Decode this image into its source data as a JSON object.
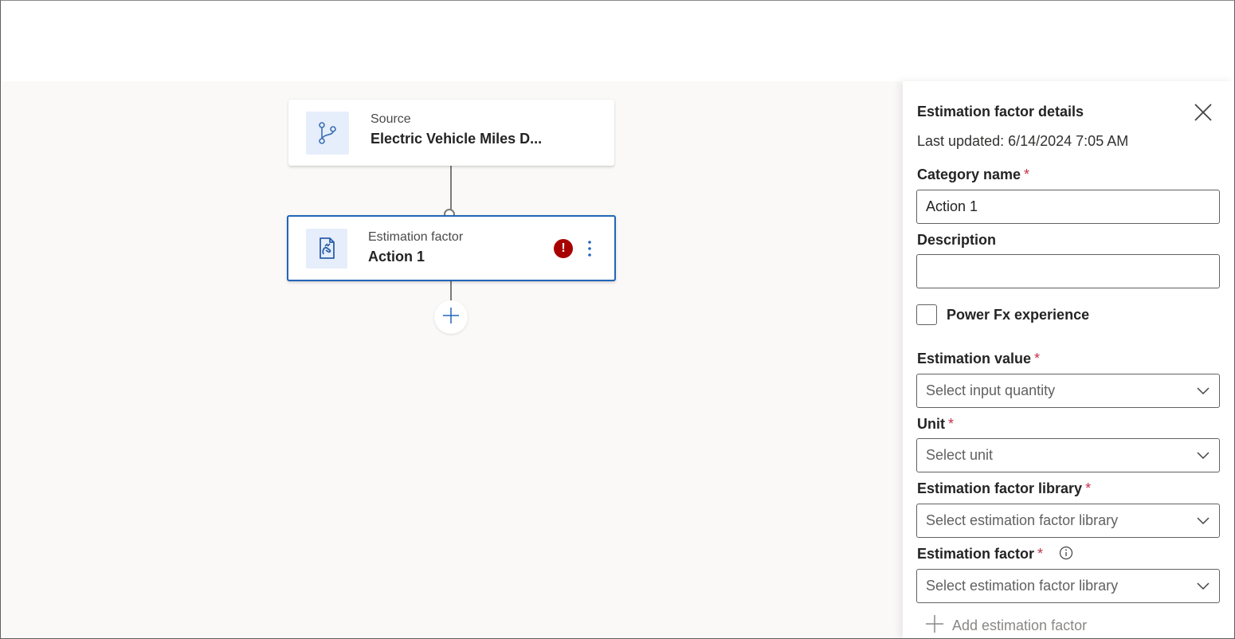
{
  "flow": {
    "source_node": {
      "kicker": "Source",
      "title": "Electric Vehicle Miles D...",
      "icon": "branch-icon"
    },
    "action_node": {
      "kicker": "Estimation factor",
      "title": "Action 1",
      "icon": "document-hand-icon",
      "error_glyph": "!",
      "more_icon": "more-vertical-icon"
    },
    "add_step_icon": "plus-icon"
  },
  "panel": {
    "title": "Estimation factor details",
    "close_icon": "close-icon",
    "last_updated": "Last updated: 6/14/2024 7:05 AM",
    "category_name": {
      "label": "Category name",
      "required": "*",
      "value": "Action 1"
    },
    "description": {
      "label": "Description",
      "value": ""
    },
    "power_fx": {
      "label": "Power Fx experience",
      "checked": false
    },
    "estimation_value": {
      "label": "Estimation value",
      "required": "*",
      "placeholder": "Select input quantity"
    },
    "unit": {
      "label": "Unit",
      "required": "*",
      "placeholder": "Select unit"
    },
    "factor_library": {
      "label": "Estimation factor library",
      "required": "*",
      "placeholder": "Select estimation factor library"
    },
    "estimation_factor": {
      "label": "Estimation factor",
      "required": "*",
      "placeholder": "Select estimation factor library",
      "info_icon": "info-icon"
    },
    "add_factor": {
      "label": "Add estimation factor",
      "icon": "plus-icon"
    }
  },
  "colors": {
    "accent": "#2266b8",
    "error": "#a80000",
    "required": "#c4314b",
    "canvas": "#faf9f8"
  }
}
